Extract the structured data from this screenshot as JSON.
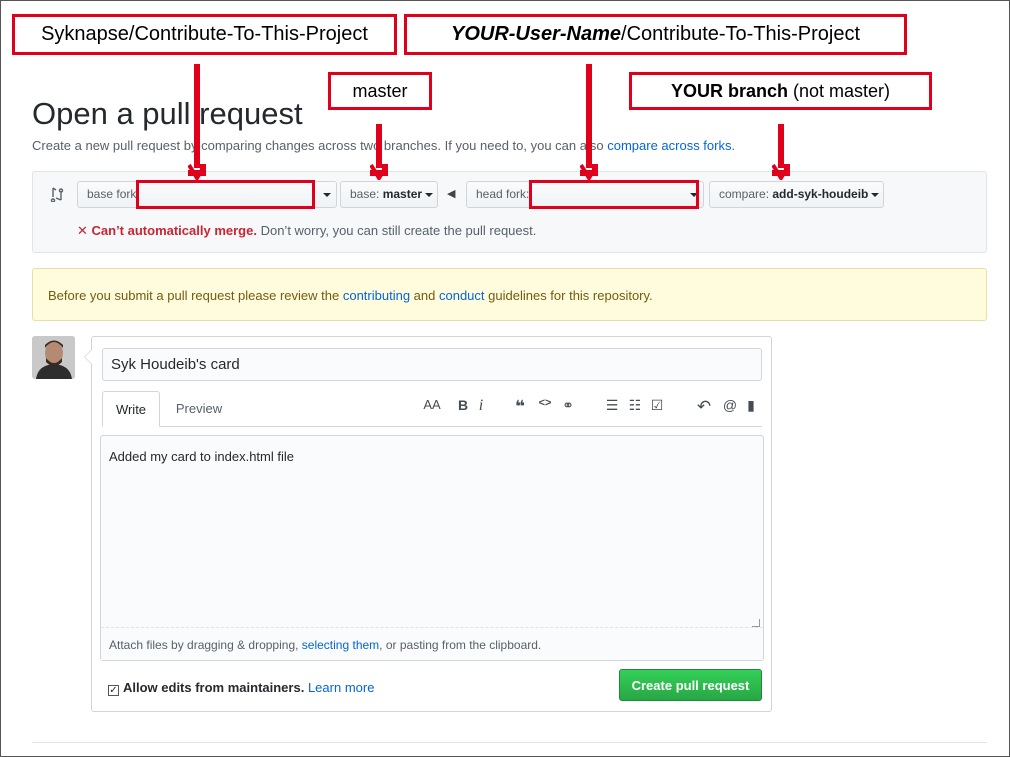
{
  "annotations": {
    "base_repo": "Syknapse/Contribute-To-This-Project",
    "head_repo_user": "YOUR-User-Name",
    "head_repo_rest": "/Contribute-To-This-Project",
    "base_branch": "master",
    "compare_branch_bold": "YOUR branch",
    "compare_branch_rest": " (not master)"
  },
  "page": {
    "title": "Open a pull request",
    "subtitle": "Create a new pull request by comparing changes across two branches. If you need to, you can also ",
    "subtitle_link": "compare across forks",
    "subtitle_end": "."
  },
  "range": {
    "base_fork_label": "base fork:",
    "base_label": "base:",
    "base_value": "master",
    "head_fork_label": "head fork:",
    "compare_label": "compare:",
    "compare_value": "add-syk-houdeib",
    "merge_status": "Can’t automatically merge.",
    "merge_hint": " Don’t worry, you can still create the pull request."
  },
  "flash": {
    "text_1": "Before you submit a pull request please review the ",
    "link_1": "contributing",
    "text_2": " and ",
    "link_2": "conduct",
    "text_3": " guidelines for this repository."
  },
  "form": {
    "title_value": "Syk Houdeib's card",
    "tab_write": "Write",
    "tab_preview": "Preview",
    "body_value": "Added my card to index.html file",
    "attach_1": "Attach files by dragging & dropping, ",
    "attach_link": "selecting them",
    "attach_2": ", or pasting from the clipboard.",
    "allow_edits": "Allow edits from maintainers.",
    "learn_more": "Learn more",
    "submit": "Create pull request"
  },
  "toolbar": {
    "text_size": "AA",
    "bold": "B",
    "italic": "i",
    "quote": "❝",
    "code": "<>",
    "link": "⚭",
    "bullet_list": "☰",
    "numbered_list": "☷",
    "task_list": "☑",
    "reply": "↶",
    "mention": "@",
    "bookmark": "▮"
  },
  "colors": {
    "annotation_red": "#e0001b",
    "link_blue": "#0366d6",
    "create_green": "#28a745",
    "error_red": "#cb2431"
  }
}
